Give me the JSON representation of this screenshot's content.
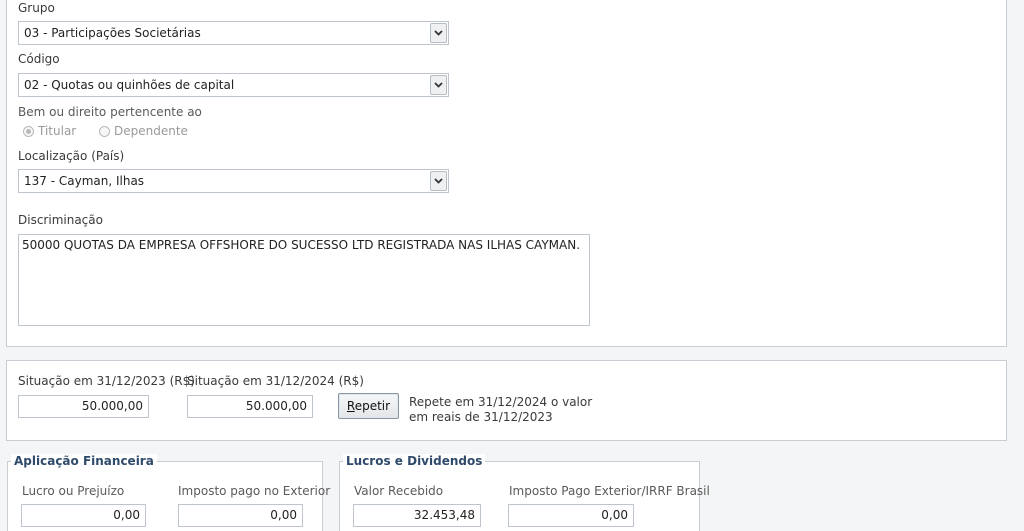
{
  "grupo": {
    "label": "Grupo",
    "selected": "03 - Participações Societárias"
  },
  "codigo": {
    "label": "Código",
    "selected": "02 - Quotas ou quinhões de capital"
  },
  "pertencente": {
    "label": "Bem ou direito pertencente ao",
    "options": [
      "Titular",
      "Dependente"
    ],
    "selected": "Titular"
  },
  "localizacao": {
    "label": "Localização (País)",
    "selected": "137 - Cayman, Ilhas"
  },
  "discriminacao": {
    "label": "Discriminação",
    "value": "50000  QUOTAS DA EMPRESA OFFSHORE DO SUCESSO LTD REGISTRADA NAS ILHAS CAYMAN."
  },
  "situacao": {
    "label_2023": "Situação em 31/12/2023 (R$)",
    "value_2023": "50.000,00",
    "label_2024": "Situação em 31/12/2024 (R$)",
    "value_2024": "50.000,00",
    "repetir_prefix": "R",
    "repetir_rest": "epetir",
    "repetir_help_line1": "Repete em 31/12/2024 o valor",
    "repetir_help_line2": "em reais de 31/12/2023"
  },
  "aplicacao": {
    "legend": "Aplicação Financeira",
    "lucro_label": "Lucro ou Prejuízo",
    "lucro_value": "0,00",
    "imposto_label": "Imposto pago no Exterior",
    "imposto_value": "0,00"
  },
  "lucros": {
    "legend": "Lucros e Dividendos",
    "valor_label": "Valor Recebido",
    "valor_value": "32.453,48",
    "imposto_label": "Imposto Pago Exterior/IRRF Brasil",
    "imposto_value": "0,00"
  },
  "icons": {
    "dropdown": "chevron-down-icon"
  }
}
